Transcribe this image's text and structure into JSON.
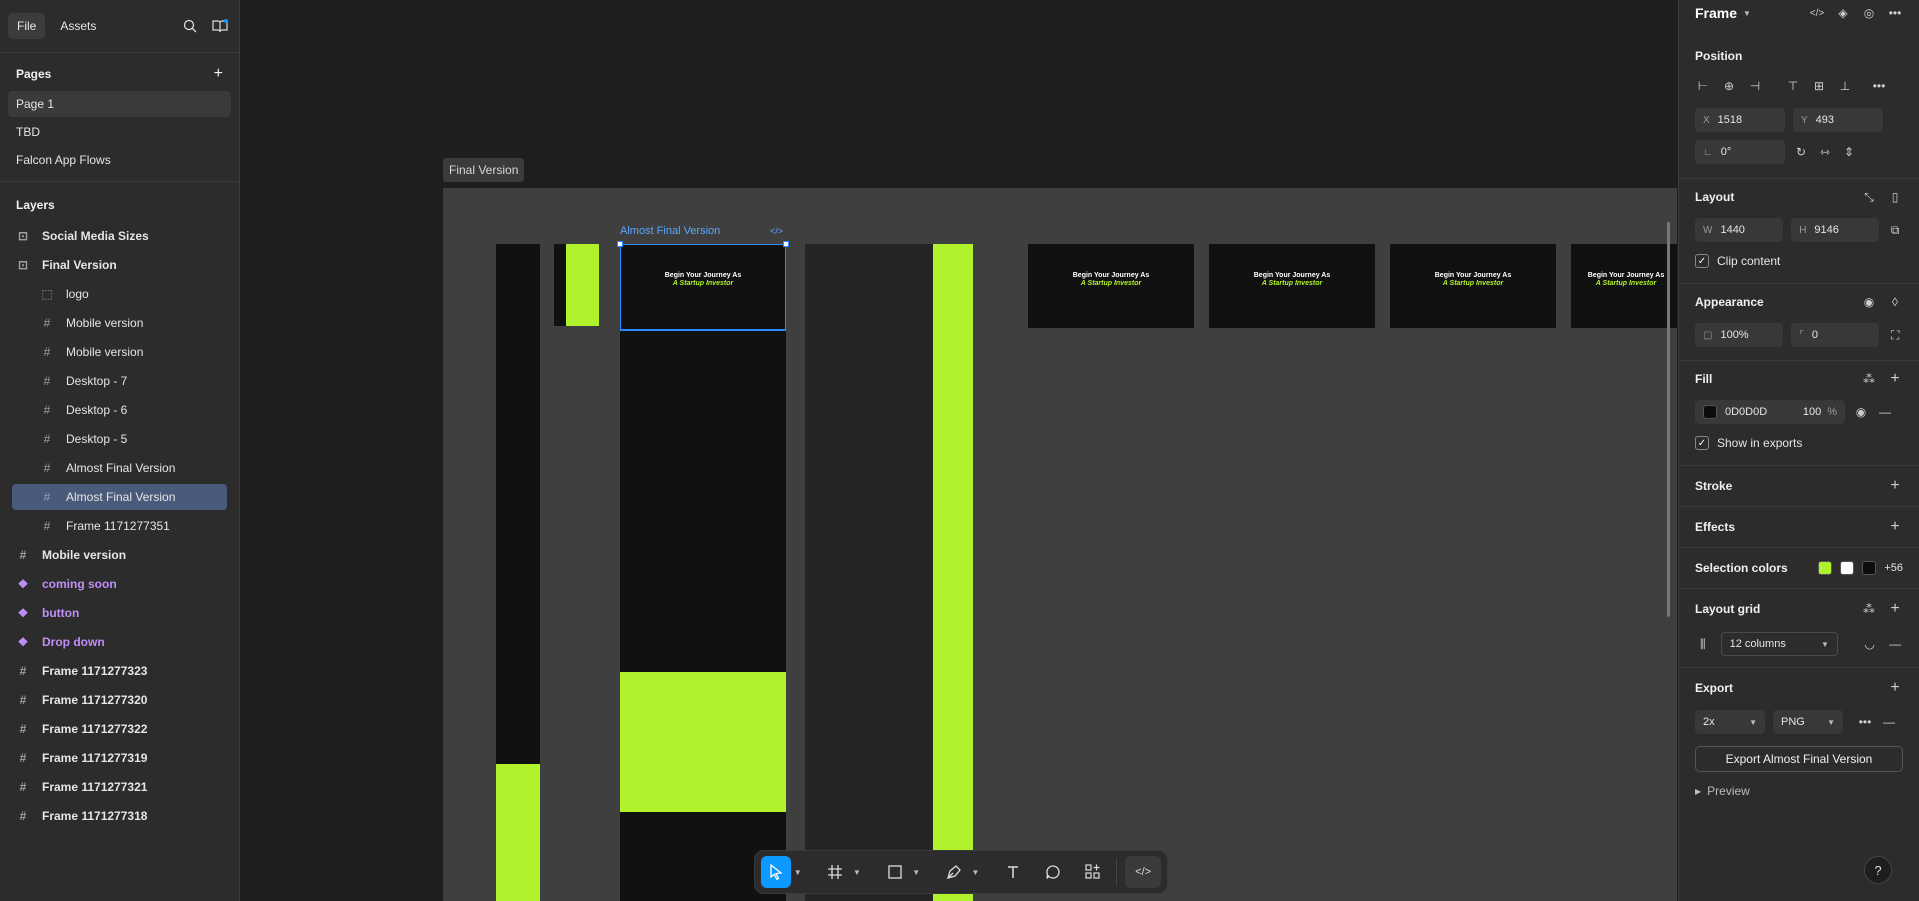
{
  "left": {
    "tabs": [
      "File",
      "Assets"
    ],
    "pages_title": "Pages",
    "pages": [
      "Page 1",
      "TBD",
      "Falcon App Flows"
    ],
    "layers_title": "Layers",
    "layers": [
      {
        "label": "Social Media Sizes",
        "type": "section",
        "bold": true
      },
      {
        "label": "Final Version",
        "type": "section",
        "bold": true
      },
      {
        "label": "logo",
        "type": "group",
        "indent": true
      },
      {
        "label": "Mobile version",
        "type": "frame",
        "indent": true
      },
      {
        "label": "Mobile version",
        "type": "frame",
        "indent": true
      },
      {
        "label": "Desktop - 7",
        "type": "frame",
        "indent": true
      },
      {
        "label": "Desktop - 6",
        "type": "frame",
        "indent": true
      },
      {
        "label": "Desktop - 5",
        "type": "frame",
        "indent": true
      },
      {
        "label": "Almost Final Version",
        "type": "frame",
        "indent": true
      },
      {
        "label": "Almost Final Version",
        "type": "frame",
        "indent": true,
        "selected": true
      },
      {
        "label": "Frame 1171277351",
        "type": "frame",
        "indent": true
      },
      {
        "label": "Mobile version",
        "type": "frame",
        "bold": true
      },
      {
        "label": "coming soon",
        "type": "component"
      },
      {
        "label": "button",
        "type": "component"
      },
      {
        "label": "Drop down",
        "type": "component"
      },
      {
        "label": "Frame 1171277323",
        "type": "frame",
        "bold": true
      },
      {
        "label": "Frame 1171277320",
        "type": "frame",
        "bold": true
      },
      {
        "label": "Frame 1171277322",
        "type": "frame",
        "bold": true
      },
      {
        "label": "Frame 1171277319",
        "type": "frame",
        "bold": true
      },
      {
        "label": "Frame 1171277321",
        "type": "frame",
        "bold": true
      },
      {
        "label": "Frame 1171277318",
        "type": "frame",
        "bold": true
      }
    ]
  },
  "canvas": {
    "section_label": "Final Version",
    "selected_label": "Almost Final Version",
    "hero_title": "Begin Your Journey As",
    "hero_sub": "A Startup Investor"
  },
  "right": {
    "frame_title": "Frame",
    "position_title": "Position",
    "x_label": "X",
    "x_value": "1518",
    "y_label": "Y",
    "y_value": "493",
    "rotation_value": "0°",
    "layout_title": "Layout",
    "w_label": "W",
    "w_value": "1440",
    "h_label": "H",
    "h_value": "9146",
    "clip_label": "Clip content",
    "appearance_title": "Appearance",
    "opacity_value": "100%",
    "radius_value": "0",
    "fill_title": "Fill",
    "fill_hex": "0D0D0D",
    "fill_opacity": "100",
    "percent": "%",
    "show_exports_label": "Show in exports",
    "stroke_title": "Stroke",
    "effects_title": "Effects",
    "selection_colors_title": "Selection colors",
    "selection_more": "+56",
    "layout_grid_title": "Layout grid",
    "grid_value": "12 columns",
    "export_title": "Export",
    "export_scale": "2x",
    "export_format": "PNG",
    "export_button": "Export Almost Final Version",
    "preview_label": "Preview"
  },
  "colors": {
    "accent_green": "#B0F22C",
    "selection_blue": "#2A8BFF",
    "fill_black": "#0D0D0D",
    "white": "#FFFFFF"
  }
}
